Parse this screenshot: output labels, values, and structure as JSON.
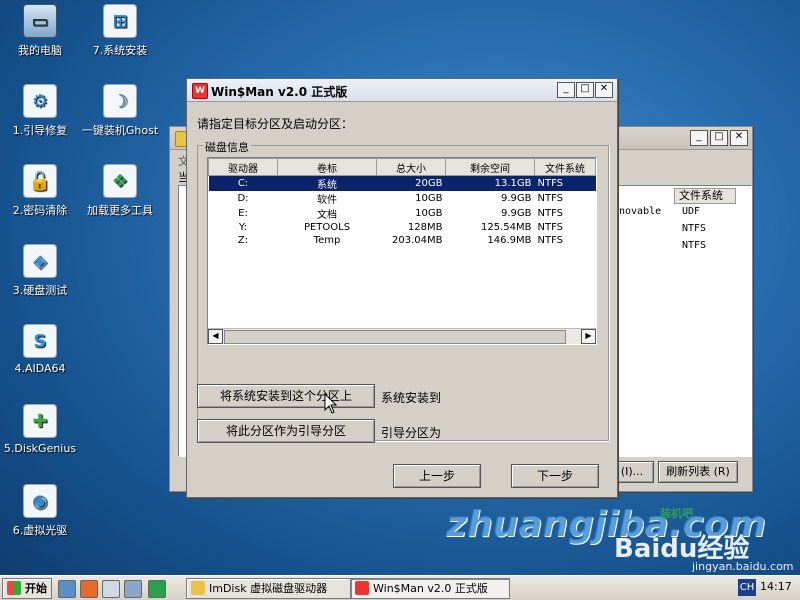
{
  "desktop_icons": [
    {
      "label": "我的电脑",
      "glyph": "▭"
    },
    {
      "label": "7.系统安装",
      "glyph": "⊞"
    },
    {
      "label": "1.引导修复",
      "glyph": "⚙"
    },
    {
      "label": "一键装机Ghost",
      "glyph": "☽"
    },
    {
      "label": "2.密码清除",
      "glyph": "🔓"
    },
    {
      "label": "加载更多工具",
      "glyph": "❖"
    },
    {
      "label": "3.硬盘测试",
      "glyph": "◈"
    },
    {
      "label": "4.AIDA64",
      "glyph": "S"
    },
    {
      "label": "5.DiskGenius",
      "glyph": "✚"
    },
    {
      "label": "6.虚拟光驱",
      "glyph": "◉"
    }
  ],
  "bg_window": {
    "label_fragment_1": "文",
    "label_fragment_2": "当",
    "col_fs": "文件系统",
    "rows": [
      {
        "type": "novable",
        "fs": "UDF"
      },
      {
        "type": "",
        "fs": "NTFS"
      },
      {
        "type": "",
        "fs": "NTFS"
      }
    ],
    "btn_partial": "(I)...",
    "btn_refresh": "刷新列表 (R)"
  },
  "main_window": {
    "title": "Win$Man v2.0 正式版",
    "prompt": "请指定目标分区及启动分区：",
    "group_label": "磁盘信息",
    "columns": [
      "驱动器",
      "卷标",
      "总大小",
      "剩余空间",
      "文件系统"
    ],
    "rows": [
      {
        "drive": "C:",
        "label": "系统",
        "total": "20GB",
        "free": "13.1GB",
        "fs": "NTFS",
        "selected": true
      },
      {
        "drive": "D:",
        "label": "软件",
        "total": "10GB",
        "free": "9.9GB",
        "fs": "NTFS",
        "selected": false
      },
      {
        "drive": "E:",
        "label": "文档",
        "total": "10GB",
        "free": "9.9GB",
        "fs": "NTFS",
        "selected": false
      },
      {
        "drive": "Y:",
        "label": "PETOOLS",
        "total": "128MB",
        "free": "125.54MB",
        "fs": "NTFS",
        "selected": false
      },
      {
        "drive": "Z:",
        "label": "Temp",
        "total": "203.04MB",
        "free": "146.9MB",
        "fs": "NTFS",
        "selected": false
      }
    ],
    "install_button": "将系统安装到这个分区上",
    "install_status": "系统安装到",
    "boot_button": "将此分区作为引导分区",
    "boot_status": "引导分区为",
    "prev_button": "上一步",
    "next_button": "下一步"
  },
  "watermark": {
    "site": "zhuangjiba.com",
    "site_tag": "装机吧",
    "baidu": "Baidu经验",
    "baidu_url": "jingyan.baidu.com"
  },
  "taskbar": {
    "start": "开始",
    "tasks": [
      {
        "label": "ImDisk 虚拟磁盘驱动器",
        "pressed": false
      },
      {
        "label": "Win$Man v2.0 正式版",
        "pressed": true
      }
    ],
    "ime": "CH",
    "clock": "14:17"
  }
}
